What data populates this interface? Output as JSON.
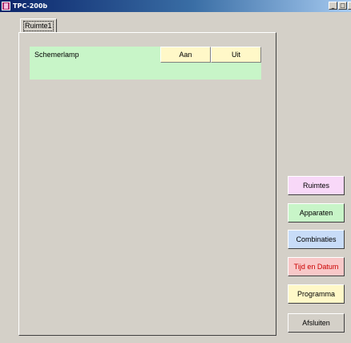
{
  "window": {
    "title": "TPC-200b"
  },
  "tabs": [
    {
      "label": "Ruimte1"
    }
  ],
  "devices": [
    {
      "name": "Schemerlamp",
      "on_label": "Aan",
      "off_label": "Uit"
    }
  ],
  "menu": {
    "ruimtes": "Ruimtes",
    "apparaten": "Apparaten",
    "combinaties": "Combinaties",
    "tijd_datum": "Tijd en Datum",
    "programma": "Programma",
    "afsluiten": "Afsluiten"
  },
  "colors": {
    "ruimtes": "#f8d8f8",
    "apparaten": "#c8f5c8",
    "combinaties": "#c8dcf8",
    "tijd_datum": "#f8c8c8",
    "programma": "#fff8c8",
    "afsluiten": "#d4d0c8",
    "device_row": "#c8f5c8",
    "device_button": "#fff8c8"
  }
}
